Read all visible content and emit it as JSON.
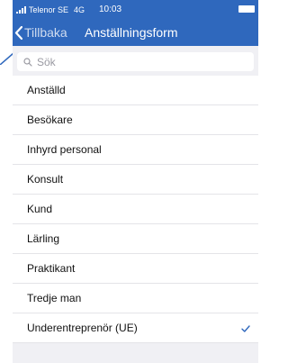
{
  "status_bar": {
    "carrier": "Telenor SE",
    "network": "4G",
    "time": "10:03"
  },
  "nav": {
    "back_label": "Tillbaka",
    "title": "Anställningsform"
  },
  "search": {
    "placeholder": "Sök"
  },
  "list": {
    "items": [
      {
        "label": "Anställd",
        "selected": false
      },
      {
        "label": "Besökare",
        "selected": false
      },
      {
        "label": "Inhyrd personal",
        "selected": false
      },
      {
        "label": "Konsult",
        "selected": false
      },
      {
        "label": "Kund",
        "selected": false
      },
      {
        "label": "Lärling",
        "selected": false
      },
      {
        "label": "Praktikant",
        "selected": false
      },
      {
        "label": "Tredje man",
        "selected": false
      },
      {
        "label": "Underentreprenör (UE)",
        "selected": true
      }
    ]
  },
  "colors": {
    "bar": "#2f68bd",
    "check": "#2f68bd",
    "group_bg": "#f0f0f4"
  },
  "icons": {
    "back": "chevron-left-icon",
    "search": "search-icon",
    "check": "checkmark-icon",
    "battery": "battery-icon",
    "signal": "signal-icon"
  }
}
